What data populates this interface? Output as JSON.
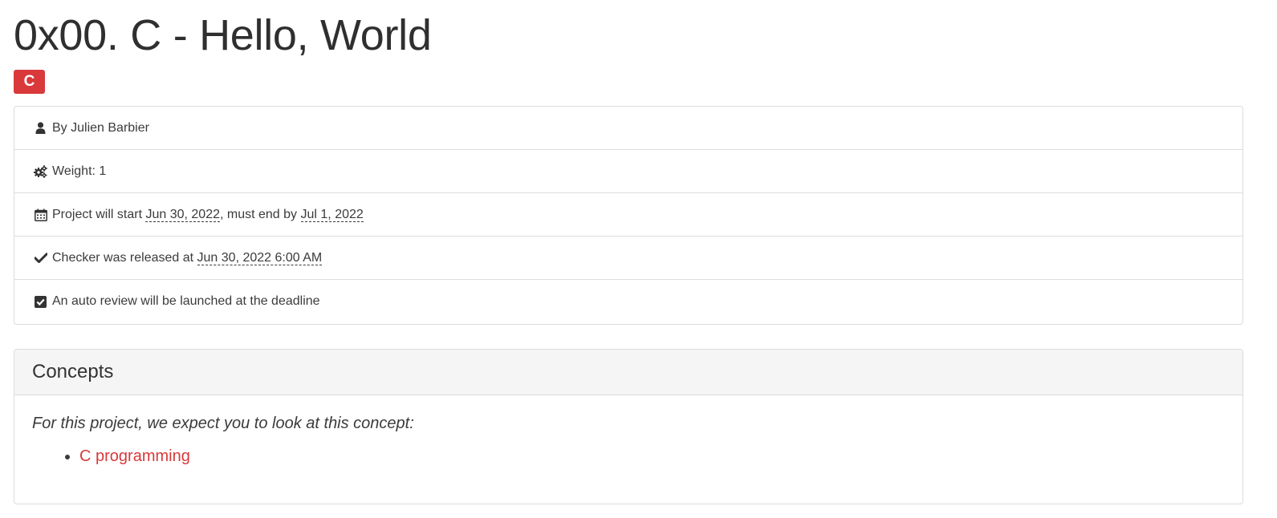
{
  "project": {
    "title": "0x00. C - Hello, World",
    "tag": "C"
  },
  "meta": {
    "author": "By Julien Barbier",
    "weight": "Weight: 1",
    "schedule_prefix": "Project will start ",
    "start_date": "Jun 30, 2022",
    "schedule_middle": ", must end by ",
    "end_date": "Jul 1, 2022",
    "checker_prefix": "Checker was released at ",
    "checker_date": "Jun 30, 2022 6:00 AM",
    "auto_review": "An auto review will be launched at the deadline",
    "icons": [
      "user-icon",
      "gears-icon",
      "calendar-icon",
      "check-icon",
      "checkbox-icon"
    ]
  },
  "concepts": {
    "heading": "Concepts",
    "intro": "For this project, we expect you to look at this concept:",
    "items": [
      {
        "label": "C programming"
      }
    ]
  },
  "colors": {
    "accent": "#d9393b",
    "text": "#3b3b3b",
    "border": "#dcdcdc",
    "header_bg": "#f5f5f5"
  }
}
